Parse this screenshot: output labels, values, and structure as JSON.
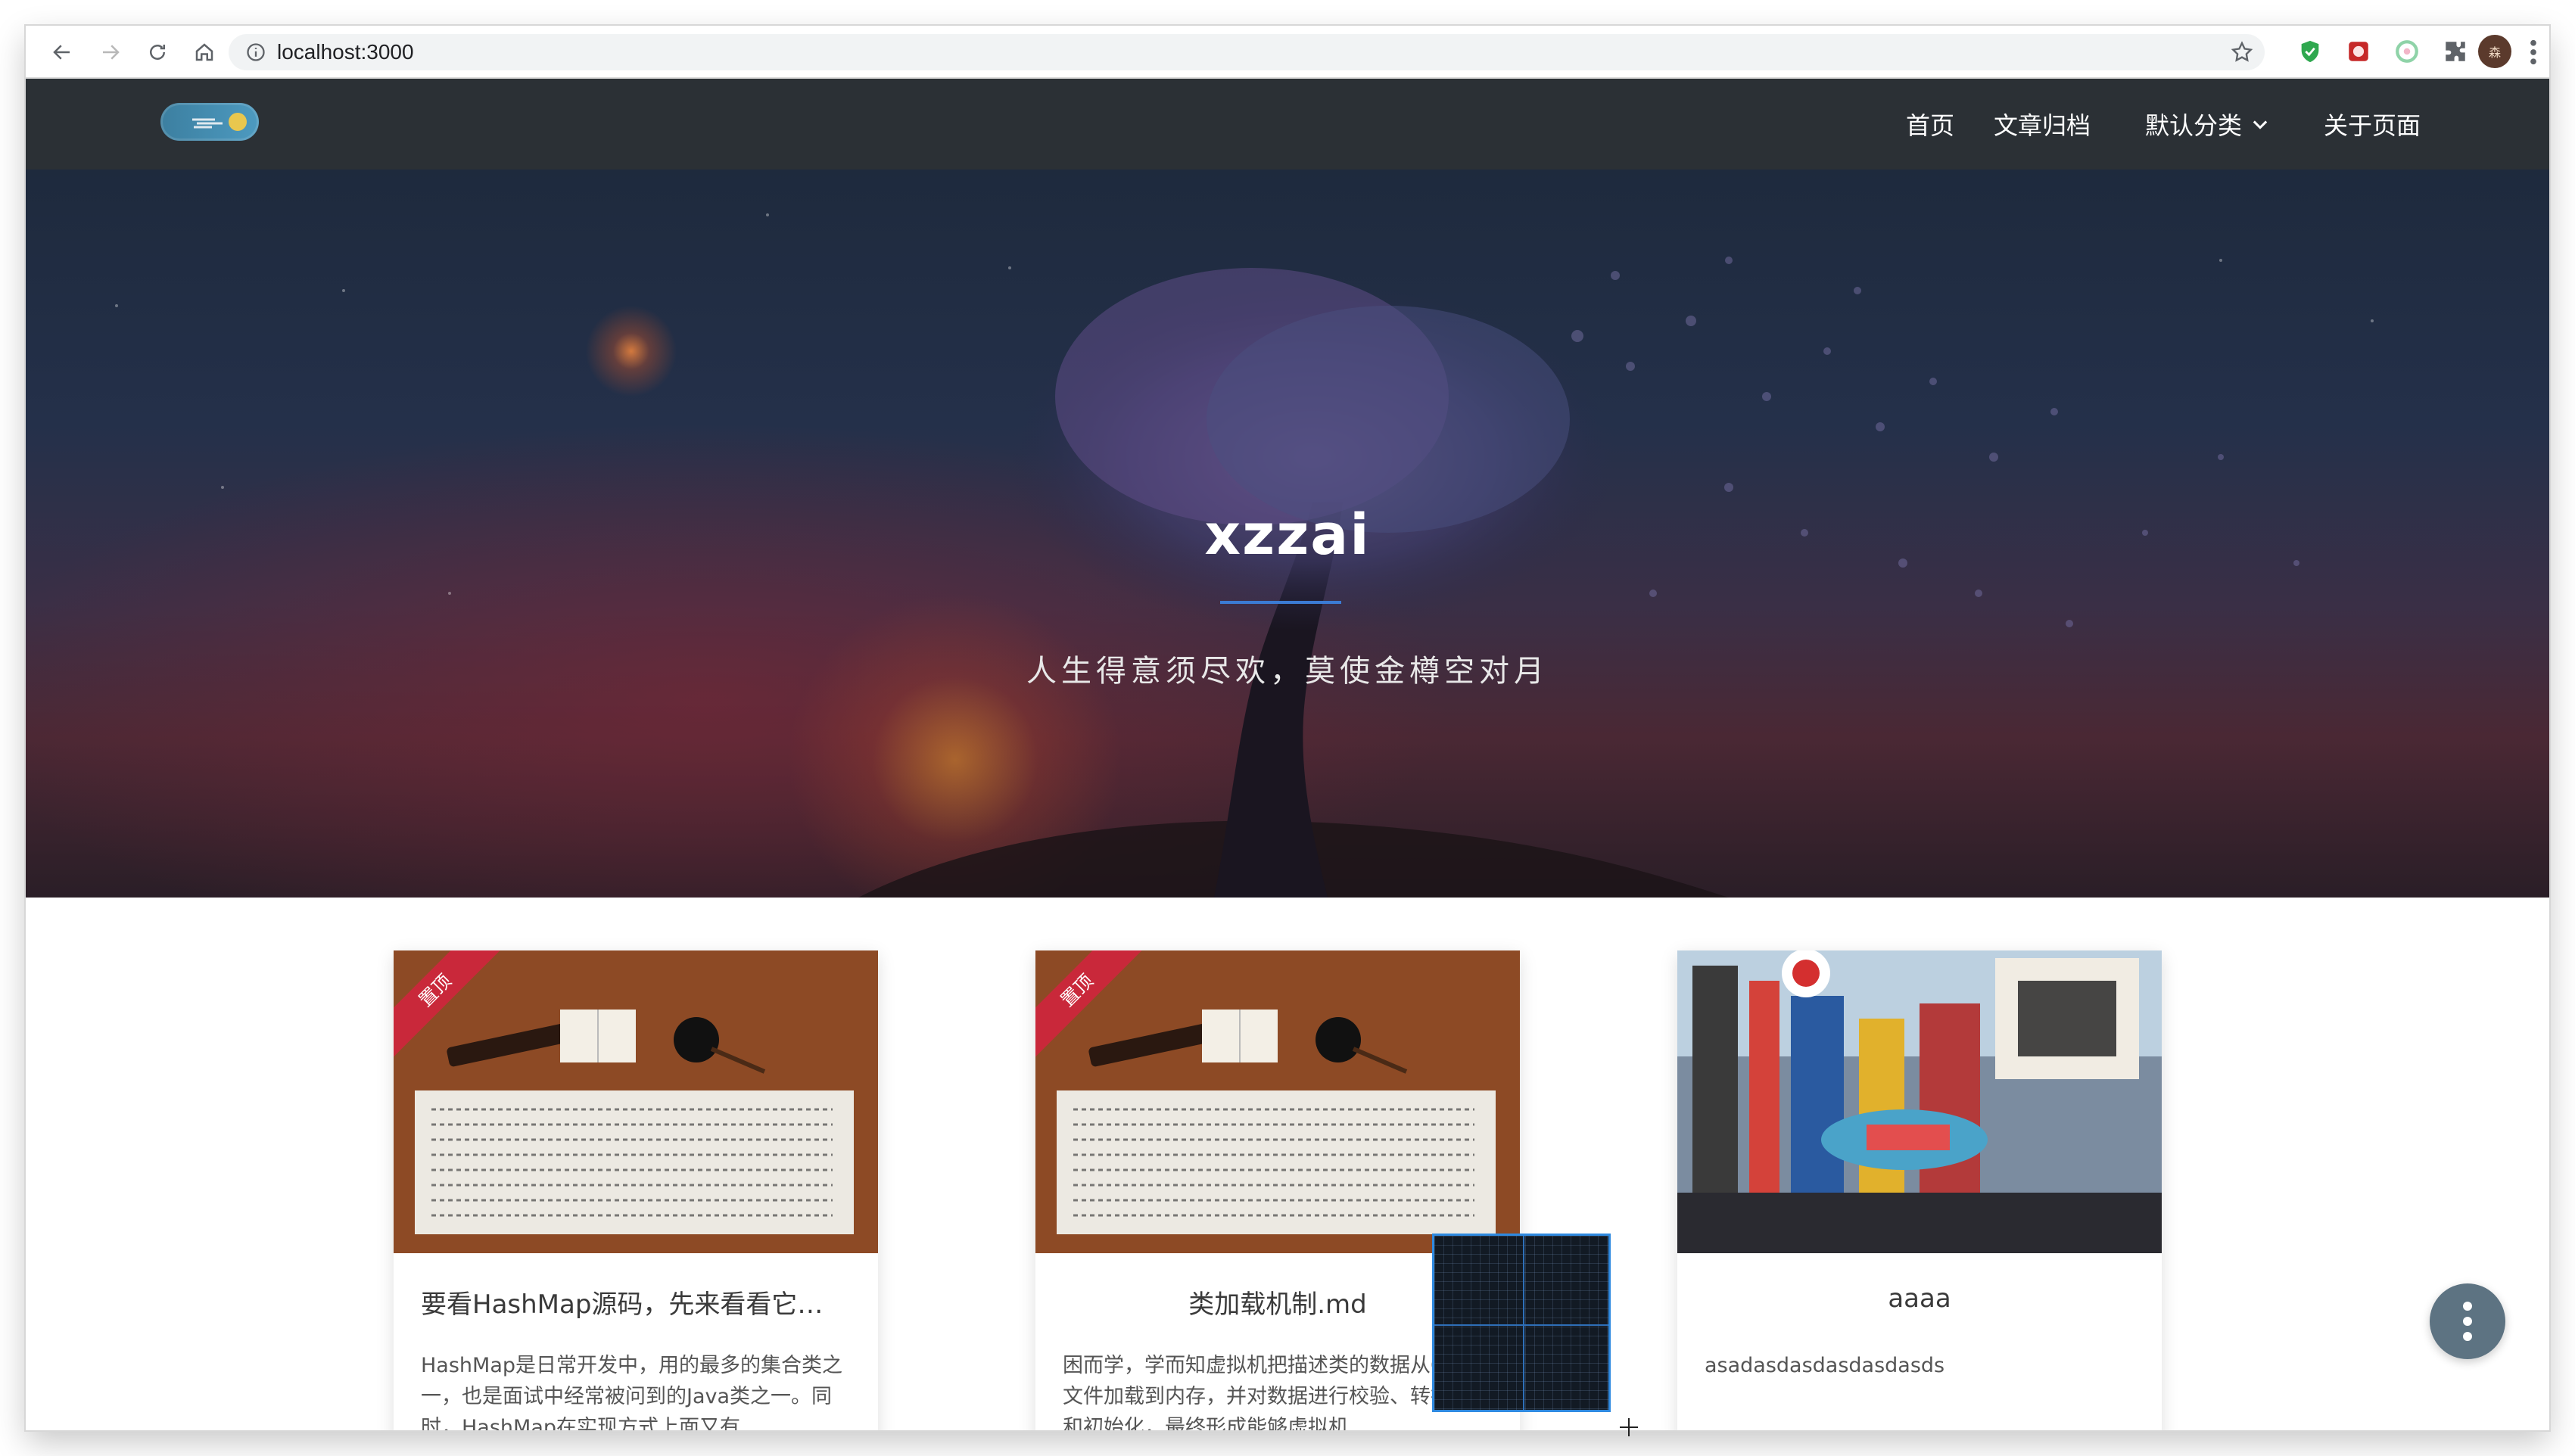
{
  "browser": {
    "url": "localhost:3000",
    "avatar_text": "森"
  },
  "site": {
    "nav": [
      {
        "label": "首页"
      },
      {
        "label": "文章归档"
      },
      {
        "label": "默认分类"
      },
      {
        "label": "关于页面"
      }
    ]
  },
  "hero": {
    "title": "xzzai",
    "subtitle": "人生得意须尽欢，莫使金樽空对月"
  },
  "posts": [
    {
      "ribbon": "置顶",
      "title": "要看HashMap源码，先来看看它…",
      "excerpt": "HashMap是日常开发中，用的最多的集合类之一，也是面试中经常被问到的Java类之一。同时，HashMap在实现方式上面又有…"
    },
    {
      "ribbon": "置顶",
      "title": "类加载机制.md",
      "excerpt": "困而学，学而知虚拟机把描述类的数据从Class文件加载到内存，并对数据进行校验、转换解析和初始化，最终形成能够虚拟机…"
    },
    {
      "ribbon": "",
      "title": "aaaa",
      "excerpt": "asadasdasdasdasdasds"
    }
  ],
  "colors": {
    "nav_bg": "#2b3035",
    "accent": "#3b7bd4",
    "ribbon": "#c9283a",
    "fab": "#5d7382"
  }
}
